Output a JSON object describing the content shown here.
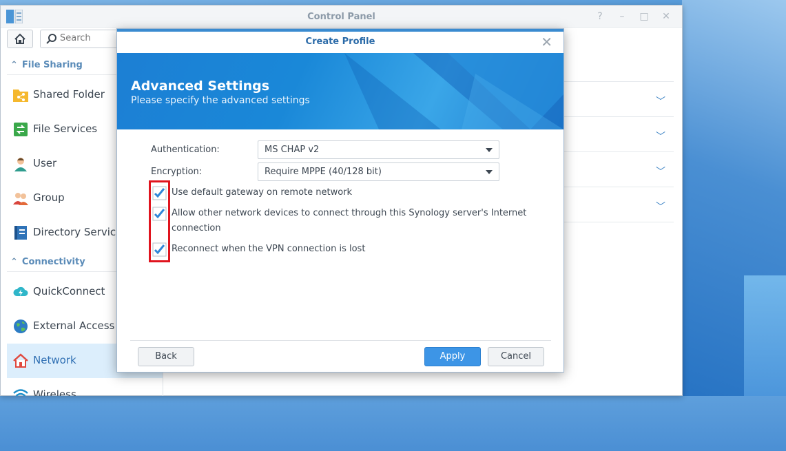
{
  "window": {
    "title": "Control Panel",
    "controls": [
      "?",
      "–",
      "□",
      "✕"
    ]
  },
  "toolbar": {
    "search_placeholder": "Search"
  },
  "sidebar": {
    "sections": [
      {
        "header": "File Sharing",
        "items": [
          {
            "label": "Shared Folder",
            "icon": "shared-folder-icon"
          },
          {
            "label": "File Services",
            "icon": "file-services-icon"
          },
          {
            "label": "User",
            "icon": "user-icon"
          },
          {
            "label": "Group",
            "icon": "group-icon"
          },
          {
            "label": "Directory Service",
            "icon": "directory-service-icon"
          }
        ]
      },
      {
        "header": "Connectivity",
        "items": [
          {
            "label": "QuickConnect",
            "icon": "quickconnect-icon"
          },
          {
            "label": "External Access",
            "icon": "external-access-icon"
          },
          {
            "label": "Network",
            "icon": "network-icon",
            "active": true
          },
          {
            "label": "Wireless",
            "icon": "wireless-icon"
          }
        ]
      }
    ]
  },
  "dialog": {
    "title": "Create Profile",
    "banner_title": "Advanced Settings",
    "banner_subtitle": "Please specify the advanced settings",
    "fields": {
      "authentication_label": "Authentication:",
      "authentication_value": "MS CHAP v2",
      "encryption_label": "Encryption:",
      "encryption_value": "Require MPPE (40/128 bit)"
    },
    "checkboxes": [
      {
        "label": "Use default gateway on remote network",
        "checked": true
      },
      {
        "label_line1": "Allow other network devices to connect through this Synology server's Internet",
        "label_line2": "connection",
        "checked": true
      },
      {
        "label": "Reconnect when the VPN connection is lost",
        "checked": true
      }
    ],
    "buttons": {
      "back": "Back",
      "apply": "Apply",
      "cancel": "Cancel"
    }
  },
  "colors": {
    "accent": "#3d95e6",
    "highlight": "#e0141e",
    "banner": "#1a88d8"
  }
}
